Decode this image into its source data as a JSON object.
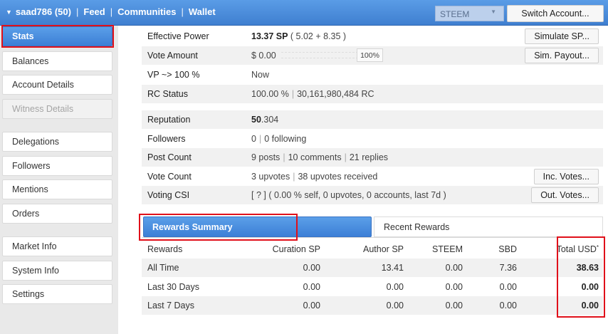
{
  "topbar": {
    "account": "saad786 (50)",
    "feed": "Feed",
    "communities": "Communities",
    "wallet": "Wallet",
    "currency": "STEEM",
    "switch_account": "Switch Account..."
  },
  "sidebar": {
    "items": [
      {
        "label": "Stats"
      },
      {
        "label": "Balances"
      },
      {
        "label": "Account Details"
      },
      {
        "label": "Witness Details"
      },
      {
        "label": "Delegations"
      },
      {
        "label": "Followers"
      },
      {
        "label": "Mentions"
      },
      {
        "label": "Orders"
      },
      {
        "label": "Market Info"
      },
      {
        "label": "System Info"
      },
      {
        "label": "Settings"
      }
    ]
  },
  "stats": {
    "effective_power": {
      "label": "Effective Power",
      "value": "13.37 SP",
      "detail": " ( 5.02 + 8.35 )",
      "button": "Simulate SP..."
    },
    "vote_amount": {
      "label": "Vote Amount",
      "value": "$ 0.00",
      "percent": "100%",
      "button": "Sim. Payout..."
    },
    "vp": {
      "label": "VP ~> 100 %",
      "value": "Now"
    },
    "rc_status": {
      "label": "RC Status",
      "value": "100.00 %",
      "detail": "30,161,980,484 RC"
    },
    "reputation": {
      "label": "Reputation",
      "value_int": "50",
      "value_dec": ".304"
    },
    "followers": {
      "label": "Followers",
      "value": "0",
      "detail": "0 following"
    },
    "post_count": {
      "label": "Post Count",
      "posts": "9 posts",
      "comments": "10 comments",
      "replies": "21 replies"
    },
    "vote_count": {
      "label": "Vote Count",
      "upvotes": "3 upvotes",
      "received": "38 upvotes received",
      "button": "Inc. Votes..."
    },
    "voting_csi": {
      "label": "Voting CSI",
      "value": "[ ? ] ( 0.00 % self, 0 upvotes, 0 accounts, last 7d )",
      "button": "Out. Votes..."
    }
  },
  "tabs": {
    "rewards_summary": "Rewards Summary",
    "recent_rewards": "Recent Rewards"
  },
  "rewards": {
    "headers": [
      "Rewards",
      "Curation SP",
      "Author SP",
      "STEEM",
      "SBD",
      "Total USD"
    ],
    "header_mark": "*",
    "rows": [
      [
        "All Time",
        "0.00",
        "13.41",
        "0.00",
        "7.36",
        "38.63"
      ],
      [
        "Last 30 Days",
        "0.00",
        "0.00",
        "0.00",
        "0.00",
        "0.00"
      ],
      [
        "Last 7 Days",
        "0.00",
        "0.00",
        "0.00",
        "0.00",
        "0.00"
      ]
    ]
  }
}
